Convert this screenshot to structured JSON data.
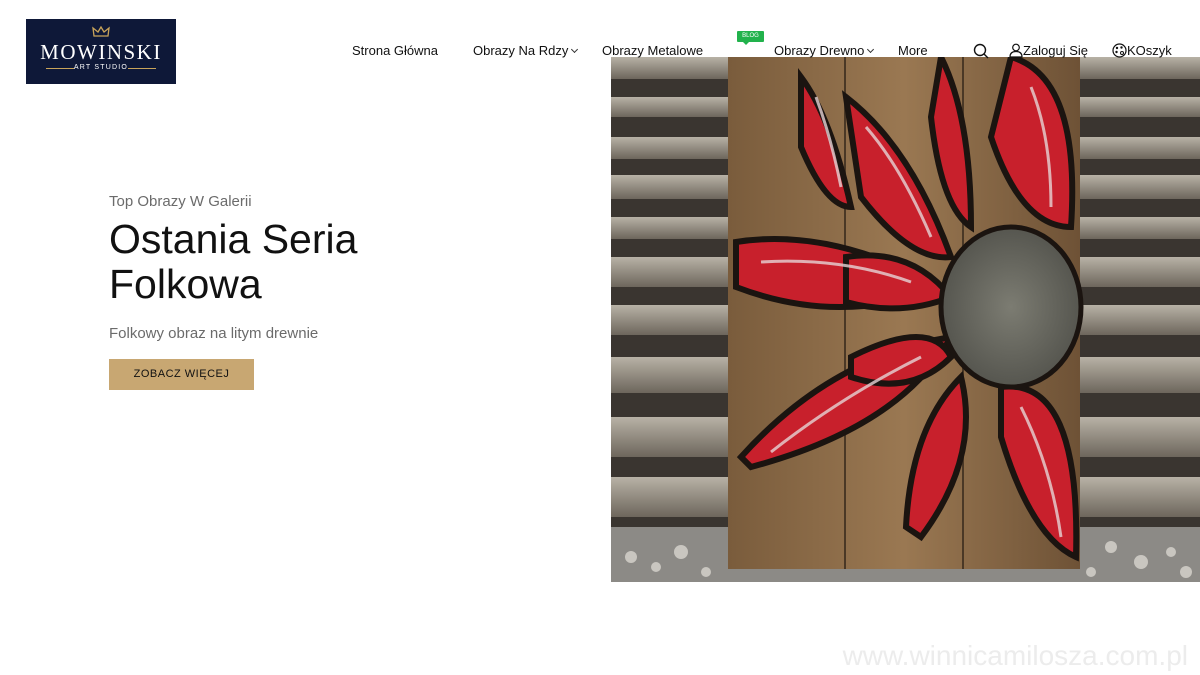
{
  "header": {
    "logo": {
      "brand": "MOWINSKI",
      "subtitle": "ART STUDIO"
    },
    "nav": [
      {
        "label": "Strona Główna"
      },
      {
        "label": "Obrazy Na Rdzy"
      },
      {
        "label": "Obrazy Metalowe"
      },
      {
        "label": "Obrazy Drewno"
      },
      {
        "label": "More"
      }
    ],
    "blog_badge": "BLOG",
    "actions": {
      "search_icon": "search-icon",
      "login_label": "Zaloguj Się",
      "cart_label": "KOszyk"
    }
  },
  "hero": {
    "eyebrow": "Top Obrazy W Galerii",
    "title_line1": "Ostania Seria",
    "title_line2": "Folkowa",
    "subtitle": "Folkowy obraz na litym drewnie",
    "cta_label": "ZOBACZ WIĘCEJ"
  },
  "watermark": "www.winnicamilosza.com.pl",
  "colors": {
    "logo_bg": "#0e1838",
    "cta_bg": "#c8a772",
    "badge_green": "#22b24c",
    "petal_red": "#c8202c",
    "center_gray": "#6e6e66"
  }
}
